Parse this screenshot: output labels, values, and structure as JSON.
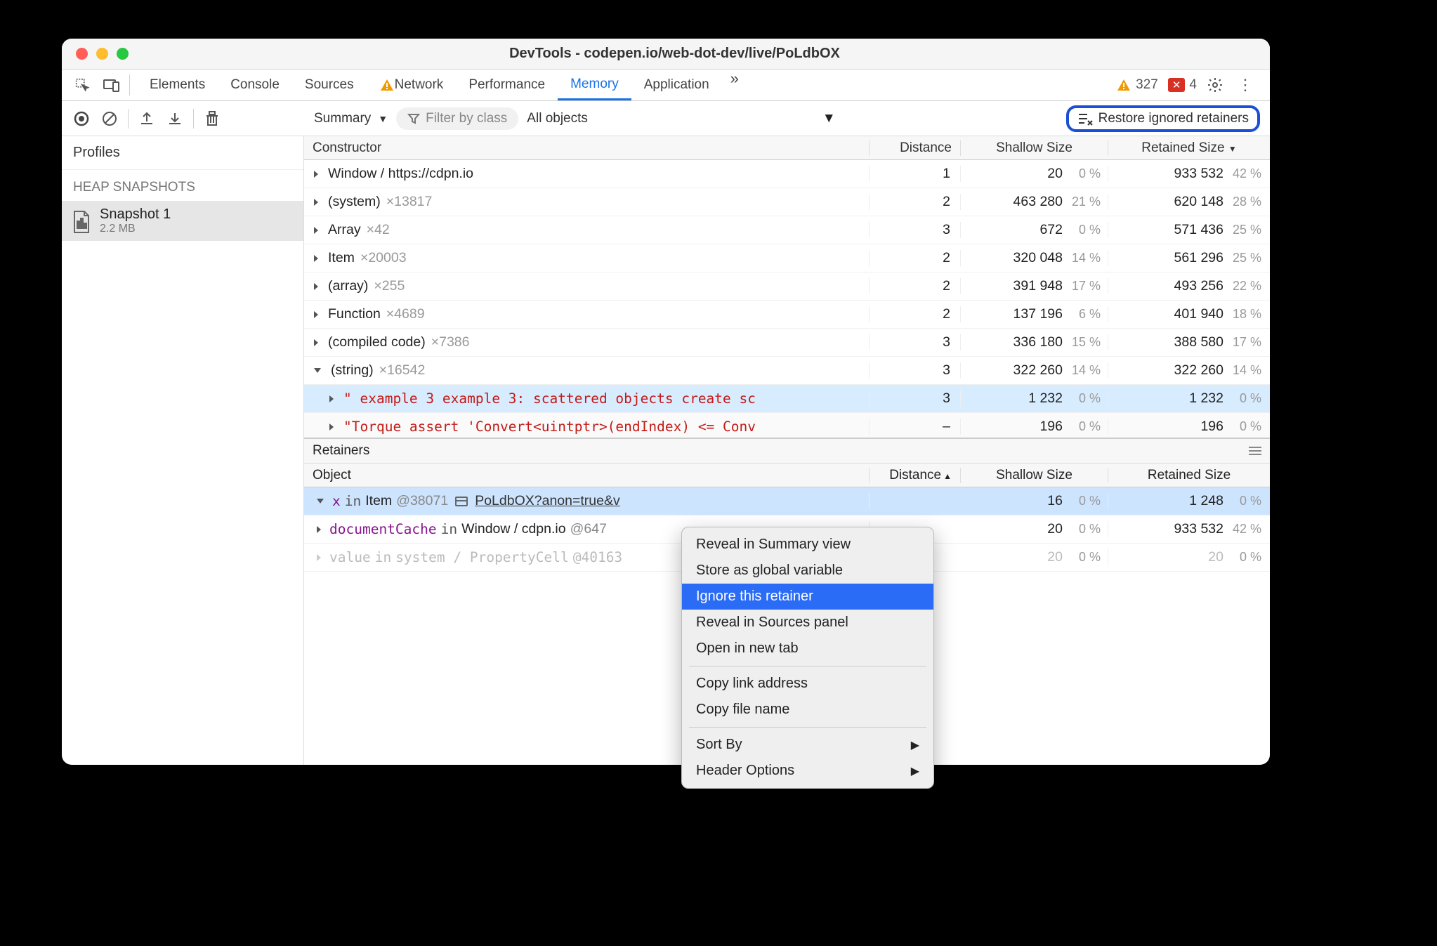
{
  "window": {
    "title": "DevTools - codepen.io/web-dot-dev/live/PoLdbOX"
  },
  "tabs": [
    "Elements",
    "Console",
    "Sources",
    "Network",
    "Performance",
    "Memory",
    "Application"
  ],
  "active_tab": "Memory",
  "status": {
    "warn_count": "327",
    "err_count": "4"
  },
  "filter": {
    "view": "Summary",
    "placeholder": "Filter by class",
    "objects": "All objects",
    "restore": "Restore ignored retainers"
  },
  "sidebar": {
    "profiles": "Profiles",
    "section": "HEAP SNAPSHOTS",
    "snapshot": {
      "name": "Snapshot 1",
      "size": "2.2 MB"
    }
  },
  "columns": {
    "constructor": "Constructor",
    "distance": "Distance",
    "shallow": "Shallow Size",
    "retained": "Retained Size"
  },
  "rows": [
    {
      "expand": "closed",
      "label": "Window / https://cdpn.io",
      "count": "",
      "distance": "1",
      "shallow": "20",
      "shallow_pct": "0 %",
      "retained": "933 532",
      "retained_pct": "42 %"
    },
    {
      "expand": "closed",
      "label": "(system)",
      "count": "×13817",
      "distance": "2",
      "shallow": "463 280",
      "shallow_pct": "21 %",
      "retained": "620 148",
      "retained_pct": "28 %"
    },
    {
      "expand": "closed",
      "label": "Array",
      "count": "×42",
      "distance": "3",
      "shallow": "672",
      "shallow_pct": "0 %",
      "retained": "571 436",
      "retained_pct": "25 %"
    },
    {
      "expand": "closed",
      "label": "Item",
      "count": "×20003",
      "distance": "2",
      "shallow": "320 048",
      "shallow_pct": "14 %",
      "retained": "561 296",
      "retained_pct": "25 %"
    },
    {
      "expand": "closed",
      "label": "(array)",
      "count": "×255",
      "distance": "2",
      "shallow": "391 948",
      "shallow_pct": "17 %",
      "retained": "493 256",
      "retained_pct": "22 %"
    },
    {
      "expand": "closed",
      "label": "Function",
      "count": "×4689",
      "distance": "2",
      "shallow": "137 196",
      "shallow_pct": "6 %",
      "retained": "401 940",
      "retained_pct": "18 %"
    },
    {
      "expand": "closed",
      "label": "(compiled code)",
      "count": "×7386",
      "distance": "3",
      "shallow": "336 180",
      "shallow_pct": "15 %",
      "retained": "388 580",
      "retained_pct": "17 %"
    },
    {
      "expand": "open",
      "label": "(string)",
      "count": "×16542",
      "distance": "3",
      "shallow": "322 260",
      "shallow_pct": "14 %",
      "retained": "322 260",
      "retained_pct": "14 %"
    }
  ],
  "string_children": [
    {
      "text": "\" example 3 example 3: scattered objects create sc",
      "distance": "3",
      "shallow": "1 232",
      "shallow_pct": "0 %",
      "retained": "1 232",
      "retained_pct": "0 %"
    },
    {
      "text": "\"Torque assert 'Convert<uintptr>(endIndex) <= Conv",
      "distance": "–",
      "shallow": "196",
      "shallow_pct": "0 %",
      "retained": "196",
      "retained_pct": "0 %"
    }
  ],
  "retainers": {
    "title": "Retainers",
    "columns": {
      "object": "Object",
      "distance": "Distance",
      "shallow": "Shallow Size",
      "retained": "Retained Size"
    },
    "rows": [
      {
        "type": "sel",
        "var": "x",
        "in": "in",
        "obj": "Item",
        "id": "@38071",
        "link": "PoLdbOX?anon=true&v",
        "distance": "",
        "shallow": "16",
        "shallow_pct": "0 %",
        "retained": "1 248",
        "retained_pct": "0 %"
      },
      {
        "type": "norm",
        "var": "documentCache",
        "in": "in",
        "obj": "Window / cdpn.io",
        "id": "@647",
        "distance": "",
        "shallow": "20",
        "shallow_pct": "0 %",
        "retained": "933 532",
        "retained_pct": "42 %"
      },
      {
        "type": "faded",
        "var": "value",
        "in": "in",
        "obj": "system / PropertyCell",
        "id": "@40163",
        "distance": "",
        "shallow": "20",
        "shallow_pct": "0 %",
        "retained": "20",
        "retained_pct": "0 %"
      }
    ]
  },
  "context_menu": {
    "items": [
      {
        "label": "Reveal in Summary view"
      },
      {
        "label": "Store as global variable"
      },
      {
        "label": "Ignore this retainer",
        "hl": true
      },
      {
        "label": "Reveal in Sources panel"
      },
      {
        "label": "Open in new tab"
      }
    ],
    "items2": [
      {
        "label": "Copy link address"
      },
      {
        "label": "Copy file name"
      }
    ],
    "items3": [
      {
        "label": "Sort By",
        "sub": true
      },
      {
        "label": "Header Options",
        "sub": true
      }
    ]
  }
}
